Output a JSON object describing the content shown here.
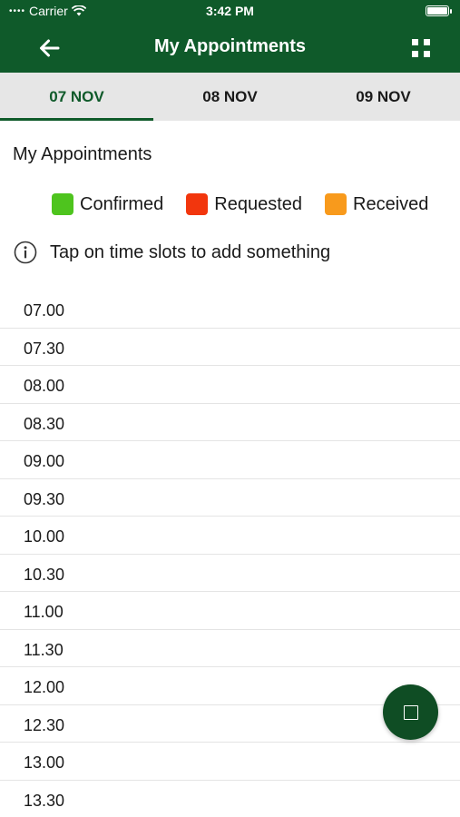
{
  "status_bar": {
    "carrier": "Carrier",
    "time": "3:42 PM"
  },
  "header": {
    "title": "My Appointments",
    "back_icon": "arrow-left-icon",
    "menu_icon": "grid-icon"
  },
  "tabs": [
    {
      "label": "07 NOV",
      "active": true
    },
    {
      "label": "08 NOV",
      "active": false
    },
    {
      "label": "09 NOV",
      "active": false
    }
  ],
  "section_title": "My Appointments",
  "legend": [
    {
      "label": "Confirmed",
      "color": "#4ec41e"
    },
    {
      "label": "Requested",
      "color": "#f2360d"
    },
    {
      "label": "Received",
      "color": "#f89a1c"
    }
  ],
  "hint": "Tap on time slots to add something",
  "slots": [
    "07.00",
    "07.30",
    "08.00",
    "08.30",
    "09.00",
    "09.30",
    "10.00",
    "10.30",
    "11.00",
    "11.30",
    "12.00",
    "12.30",
    "13.00",
    "13.30"
  ],
  "colors": {
    "brand": "#0f5a2a",
    "tab_bar": "#e6e6e6",
    "fab": "#0f4d24"
  }
}
